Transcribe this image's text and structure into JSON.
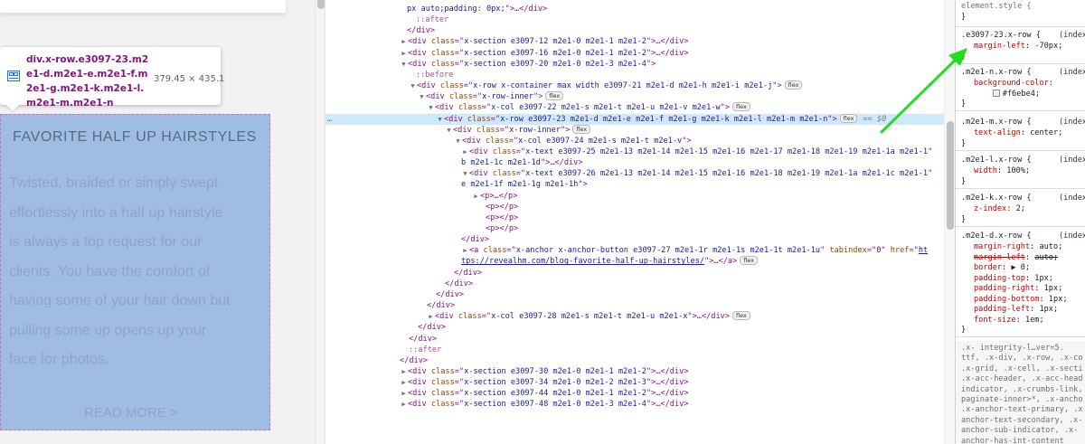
{
  "page": {
    "tooltip": {
      "selector": "div.x-row.e3097-23.m2e1-d.m2e1-e.m2e1-f.m2e1-g.m2e1-k.m2e1-l.m2e1-m.m2e1-n",
      "size": "379.45 × 435.1",
      "icon": "flex-container-icon"
    },
    "content": {
      "title": "FAVORITE HALF UP HAIRSTYLES",
      "body_lines": [
        "Twisted, braided or simply swept",
        "effortlessly into a half up hairstyle",
        "is always a top request for our",
        "clients. You have the comfort of",
        "having some of your hair down but",
        "pulling some up opens up your",
        "face for photos."
      ],
      "read_more": "READ MORE >"
    }
  },
  "dom": {
    "lines": [
      {
        "t": "text",
        "v": "px auto;padding: 0px;\">…</div>"
      },
      {
        "t": "pseudo",
        "v": "::after"
      },
      {
        "t": "close",
        "v": "</div>"
      },
      {
        "t": "div",
        "tw": "▶",
        "cls": "x-section e3097-12 m2e1-0 m2e1-1 m2e1-2",
        "tail": ">…</div>"
      },
      {
        "t": "div",
        "tw": "▶",
        "cls": "x-section e3097-16 m2e1-0 m2e1-1 m2e1-2",
        "tail": ">…</div>"
      },
      {
        "t": "div",
        "tw": "▼",
        "cls": "x-section e3097-20 m2e1-0 m2e1-3 m2e1-4",
        "tail": ">"
      },
      {
        "t": "pseudo",
        "v": "::before"
      },
      {
        "t": "div",
        "tw": "▼",
        "cls": "x-row x-container max width e3097-21 m2e1-d m2e1-h m2e1-i m2e1-j",
        "tail": ">",
        "badge": "flex"
      },
      {
        "t": "div",
        "tw": "▼",
        "cls": "x-row-inner",
        "tail": ">",
        "badge": "flex"
      },
      {
        "t": "div",
        "tw": "▼",
        "cls": "x-col e3097-22 m2e1-s m2e1-t m2e1-u m2e1-v m2e1-w",
        "tail": ">",
        "badge": "flex"
      },
      {
        "t": "div",
        "tw": "▼",
        "cls": "x-row e3097-23 m2e1-d m2e1-e m2e1-f m2e1-g m2e1-k m2e1-l m2e1-m m2e1-n",
        "tail": ">",
        "badge": "flex",
        "selected": true,
        "eq": "== $0"
      },
      {
        "t": "div",
        "tw": "▼",
        "cls": "x-row-inner",
        "tail": ">",
        "badge": "flex"
      },
      {
        "t": "div",
        "tw": "▼",
        "cls": "x-col e3097-24 m2e1-s m2e1-t m2e1-v",
        "tail": ">"
      },
      {
        "t": "div",
        "tw": "▶",
        "cls": "x-text e3097-25 m2e1-13 m2e1-14 m2e1-15 m2e1-16 m2e1-17 m2e1-18 m2e1-19 m2e1-1a m2e1-1",
        "tail": ""
      },
      {
        "t": "cont",
        "v": "b m2e1-1c m2e1-1d\">…</div>"
      },
      {
        "t": "div",
        "tw": "▼",
        "cls": "x-text e3097-26 m2e1-13 m2e1-14 m2e1-15 m2e1-16 m2e1-18 m2e1-19 m2e1-1a m2e1-1c m2e1-1",
        "tail": ""
      },
      {
        "t": "cont",
        "v": "e m2e1-1f m2e1-1g m2e1-1h\">"
      },
      {
        "t": "p",
        "tw": "▶",
        "v": "<p>…</p>"
      },
      {
        "t": "p",
        "tw": "",
        "v": "<p></p>"
      },
      {
        "t": "p",
        "tw": "",
        "v": "<p></p>"
      },
      {
        "t": "p",
        "tw": "",
        "v": "<p></p>"
      },
      {
        "t": "close",
        "v": "</div>"
      },
      {
        "t": "anchor",
        "tw": "▶",
        "cls": "x-anchor x-anchor-button e3097-27 m2e1-1r m2e1-1s m2e1-1t m2e1-1u",
        "tabindex": "0",
        "href1": "ht"
      },
      {
        "t": "link",
        "href2": "tps://revealhm.com/blog-favorite-half-up-hairstyles/",
        "tail": "\">…</a>",
        "badge": "flex"
      },
      {
        "t": "close",
        "v": "</div>"
      },
      {
        "t": "close",
        "v": "</div>"
      },
      {
        "t": "close",
        "v": "</div>"
      },
      {
        "t": "close",
        "v": "</div>"
      },
      {
        "t": "div",
        "tw": "▶",
        "cls": "x-col e3097-28 m2e1-s m2e1-t m2e1-u m2e1-x",
        "tail": ">…</div>",
        "badge": "flex"
      },
      {
        "t": "close",
        "v": "</div>"
      },
      {
        "t": "close",
        "v": "</div>"
      },
      {
        "t": "pseudo",
        "v": "::after"
      },
      {
        "t": "close",
        "v": "</div>"
      },
      {
        "t": "div",
        "tw": "▶",
        "cls": "x-section e3097-30 m2e1-0 m2e1-1 m2e1-2",
        "tail": ">…</div>"
      },
      {
        "t": "div",
        "tw": "▶",
        "cls": "x-section e3097-34 m2e1-0 m2e1-2 m2e1-3",
        "tail": ">…</div>"
      },
      {
        "t": "div",
        "tw": "▶",
        "cls": "x-section e3097-44 m2e1-0 m2e1-1 m2e1-2",
        "tail": ">…</div>"
      },
      {
        "t": "div",
        "tw": "▶",
        "cls": "x-section e3097-48 m2e1-0 m2e1-3 m2e1-4",
        "tail": ">…</div>"
      }
    ]
  },
  "styles": {
    "element_style": "element.style {",
    "close": "}",
    "source_label": "(index",
    "rules": [
      {
        "selector": ".e3097-23.x-row {",
        "props": [
          {
            "n": "margin-left",
            "v": "-70px;"
          }
        ]
      },
      {
        "selector": ".m2e1-n.x-row {",
        "props": [
          {
            "n": "background-color",
            "v": "#f6ebe4;",
            "swatch": "#f6ebe4"
          }
        ]
      },
      {
        "selector": ".m2e1-m.x-row {",
        "props": [
          {
            "n": "text-align",
            "v": "center;"
          }
        ]
      },
      {
        "selector": ".m2e1-l.x-row {",
        "props": [
          {
            "n": "width",
            "v": "100%;"
          }
        ]
      },
      {
        "selector": ".m2e1-k.x-row {",
        "props": [
          {
            "n": "z-index",
            "v": "2;"
          }
        ]
      },
      {
        "selector": ".m2e1-d.x-row {",
        "props": [
          {
            "n": "margin-right",
            "v": "auto;"
          },
          {
            "n": "margin-left",
            "v": "auto;",
            "strike": true
          },
          {
            "n": "border",
            "v": "▶ 0;"
          },
          {
            "n": "padding-top",
            "v": "1px;"
          },
          {
            "n": "padding-right",
            "v": "1px;"
          },
          {
            "n": "padding-bottom",
            "v": "1px;"
          },
          {
            "n": "padding-left",
            "v": "1px;"
          },
          {
            "n": "font-size",
            "v": "1em;"
          }
        ]
      }
    ],
    "inherited_lines": [
      ".x-        integrity-l…ver=5.",
      "ttf, .x-div, .x-row, .x-co",
      ".x-grid, .x-cell, .x-secti",
      ".x-acc-header, .x-acc-head",
      "indicator, .x-crumbs-link,",
      "paginate-inner>*, .x-ancho",
      ".x-anchor-text-primary, .x",
      "anchor-text-secondary, .x-",
      "anchor-sub-indicator, .x-",
      "anchor-has-int-content"
    ]
  },
  "colors": {
    "highlight": "#9fbde2",
    "highlight_border": "#d070b8",
    "tag": "#881280",
    "attr_name": "#994500",
    "attr_value": "#1a1aa6",
    "css_prop": "#c80000",
    "arrow": "#22dd22"
  }
}
